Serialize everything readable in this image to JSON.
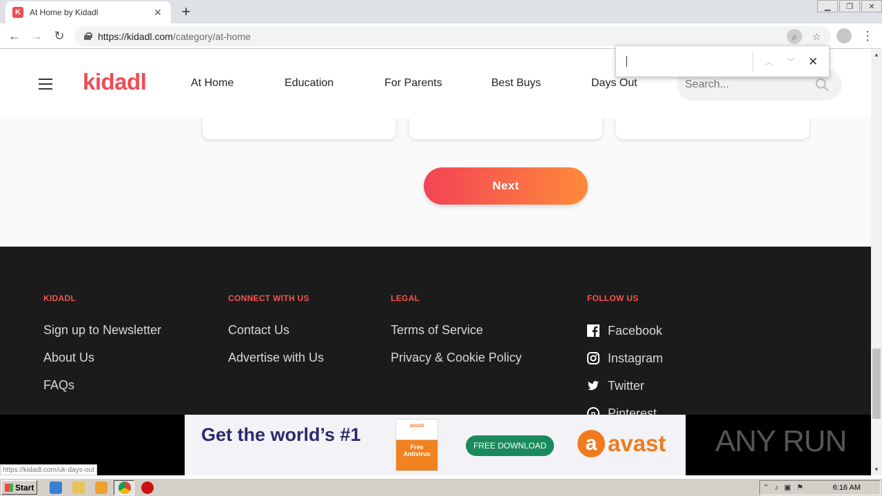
{
  "browser": {
    "tab_title": "At Home by Kidadl",
    "favicon_letter": "K",
    "url_host": "https://kidadl.com",
    "url_path": "/category/at-home",
    "status_url": "https://kidadl.com/uk-days-out"
  },
  "find_bar": {
    "value": ""
  },
  "header": {
    "logo": "kidadl",
    "nav": [
      "At Home",
      "Education",
      "For Parents",
      "Best Buys",
      "Days Out"
    ],
    "search_placeholder": "Search..."
  },
  "pagination": {
    "next_label": "Next"
  },
  "footer": {
    "columns": [
      {
        "heading": "KIDADL",
        "links": [
          "Sign up to Newsletter",
          "About Us",
          "FAQs"
        ]
      },
      {
        "heading": "CONNECT WITH US",
        "links": [
          "Contact Us",
          "Advertise with Us"
        ]
      },
      {
        "heading": "LEGAL",
        "links": [
          "Terms of Service",
          "Privacy & Cookie Policy"
        ]
      },
      {
        "heading": "FOLLOW US",
        "links": [
          "Facebook",
          "Instagram",
          "Twitter",
          "Pinterest"
        ]
      }
    ]
  },
  "ad": {
    "headline": "Get the world’s #1",
    "box_brand": "avast",
    "box_name": "Free Antivirus",
    "cta": "FREE DOWNLOAD",
    "brand": "avast"
  },
  "watermark": "ANY RUN",
  "taskbar": {
    "start": "Start",
    "clock": "6:16 AM"
  },
  "colors": {
    "brand": "#ef4c54",
    "footer_bg": "#1b1b1b",
    "footer_heading": "#f7524d",
    "cta_gradient": [
      "#f34356",
      "#fe8a3a"
    ]
  }
}
